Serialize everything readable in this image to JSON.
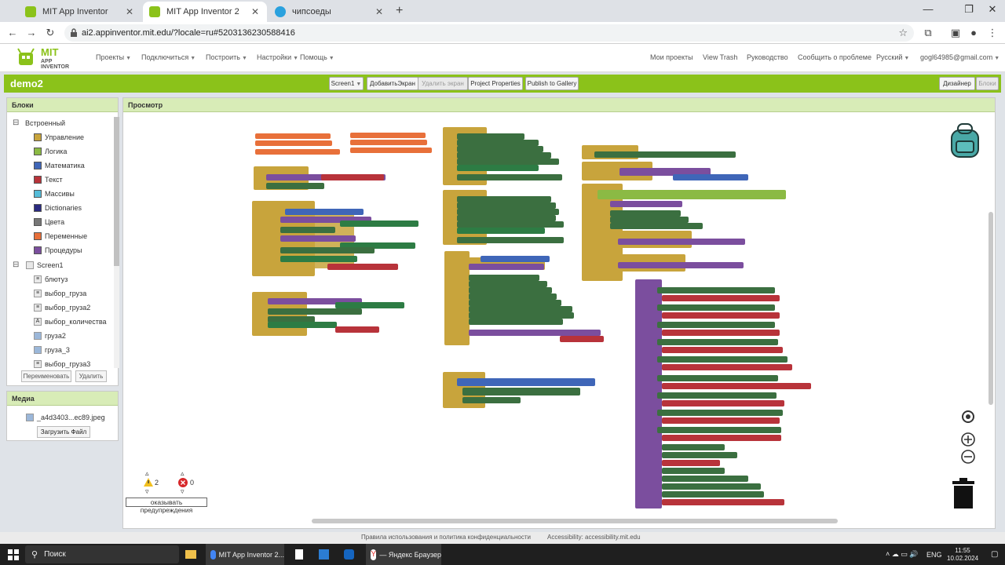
{
  "browser": {
    "tabs": [
      {
        "title": "MIT App Inventor",
        "active": false
      },
      {
        "title": "MIT App Inventor 2",
        "active": true
      },
      {
        "title": "чипсоеды",
        "active": false
      }
    ],
    "url": "ai2.appinventor.mit.edu/?locale=ru#5203136230588416"
  },
  "header": {
    "logo_title": "MIT",
    "logo_subtitle": "APP INVENTOR",
    "menu_left": [
      "Проекты",
      "Подключиться",
      "Построить",
      "Настройки",
      "Помощь"
    ],
    "menu_right": [
      "Мои проекты",
      "View Trash",
      "Руководство",
      "Сообщить о проблеме",
      "Русский",
      "gogl64985@gmail.com"
    ]
  },
  "project_bar": {
    "name": "demo2",
    "screen_select": "Screen1",
    "add_screen": "ДобавитьЭкран",
    "remove_screen": "Удалить экран",
    "properties": "Project Properties",
    "publish": "Publish to Gallery",
    "designer": "Дизайнер",
    "blocks": "Блоки"
  },
  "blocks_panel": {
    "title": "Блоки",
    "builtin_label": "Встроенный",
    "builtin": [
      {
        "label": "Управление",
        "color": "#c8a43c"
      },
      {
        "label": "Логика",
        "color": "#8bba44"
      },
      {
        "label": "Математика",
        "color": "#3f66b8"
      },
      {
        "label": "Текст",
        "color": "#b8333a"
      },
      {
        "label": "Массивы",
        "color": "#55bcd8"
      },
      {
        "label": "Dictionaries",
        "color": "#2a2a80"
      },
      {
        "label": "Цвета",
        "color": "#777777"
      },
      {
        "label": "Переменные",
        "color": "#e8703a"
      },
      {
        "label": "Процедуры",
        "color": "#7b4e9e"
      }
    ],
    "screen_label": "Screen1",
    "components": [
      "блютуз",
      "выбор_груза",
      "выбор_груза2",
      "выбор_количества",
      "груза2",
      "груза_3",
      "выбор_груза3"
    ],
    "rename_button": "Переименовать",
    "delete_button": "Удалить"
  },
  "media_panel": {
    "title": "Медиа",
    "file": "_a4d3403...ec89.jpeg",
    "upload_button": "Загрузить Файл"
  },
  "viewer": {
    "title": "Просмотр",
    "warnings_count": "2",
    "errors_count": "0",
    "show_warnings": "оказывать предупреждения"
  },
  "footer": {
    "terms": "Правила использования и политика конфиденциальности",
    "accessibility": "Accessibility: accessibility.mit.edu"
  },
  "taskbar": {
    "search": "Поиск",
    "app1": "MIT App Inventor 2...",
    "app2": "— Яндекс Браузер",
    "lang": "ENG",
    "time": "11:55",
    "date": "10.02.2024"
  }
}
